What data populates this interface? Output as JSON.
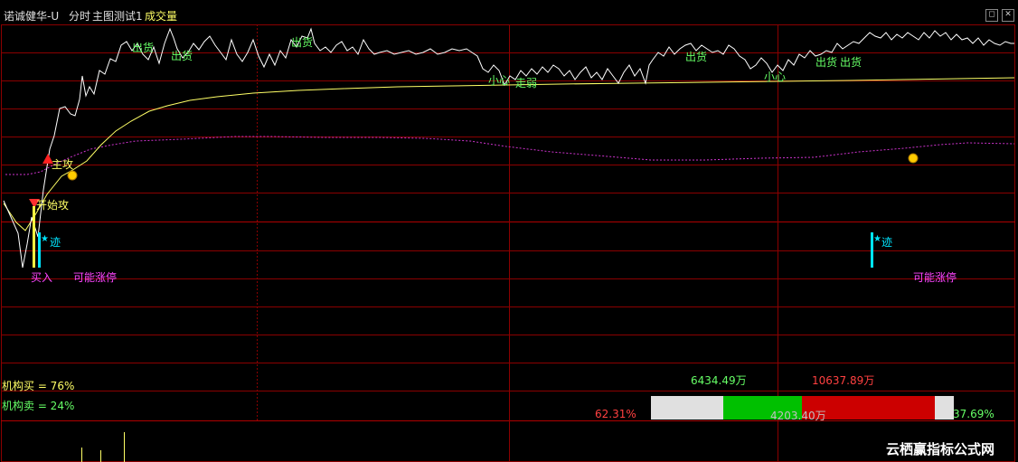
{
  "header": {
    "stock_name": "诺诚健华-U",
    "mode": "分时",
    "indicator": "主图测试1",
    "volume_label": "成交量"
  },
  "window_buttons": {
    "restore": "◻",
    "close": "✕"
  },
  "signals": {
    "chuhuo_1": "出货",
    "chuhuo_2": "出货",
    "chuhuo_3": "出货",
    "chuhuo_4": "出货",
    "chuhuo_5": "出货",
    "chuhuo_6": "出货",
    "xiaoxin_1": "小心",
    "zouruo": "走弱",
    "xiaoxin_2": "小心",
    "zhugong": "主攻",
    "kaishigong": "开始攻",
    "ji_1": "迹",
    "ji_2": "迹",
    "mairu": "买入",
    "kenengzhangting_1": "可能涨停",
    "kenengzhangting_2": "可能涨停"
  },
  "institutions": {
    "buy_label": "机构买 = 76%",
    "sell_label": "机构卖 = 24%",
    "buy_amount": "6434.49万",
    "sell_amount": "10637.89万",
    "net_amount": "4203.40万",
    "buy_pct": "62.31%",
    "sell_pct": "37.69%",
    "bar_green_fraction": 0.3769,
    "bar_red_fraction": 0.6231
  },
  "colors": {
    "price_line": "#ffffff",
    "avg_line": "#ffff66",
    "ma_line": "#cc33cc",
    "grid": "#8b0000",
    "signal_green": "#66ff66",
    "signal_cyan": "#00e5ff",
    "signal_magenta": "#ff44ff",
    "bar_green": "#00c000",
    "bar_red": "#cc0000"
  },
  "watermark": "云栖赢指标公式网"
}
